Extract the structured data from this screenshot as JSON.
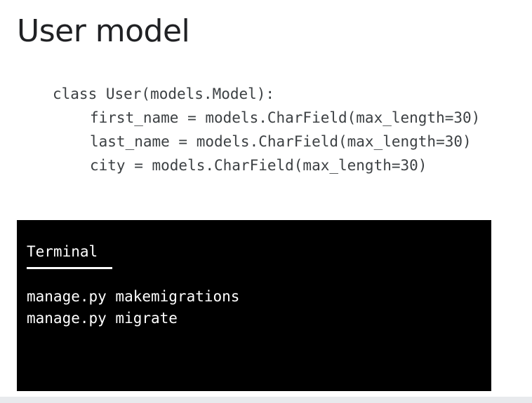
{
  "slide": {
    "title": "User model"
  },
  "code": {
    "lines": [
      "class User(models.Model):",
      "first_name = models.CharField(max_length=30)",
      "last_name = models.CharField(max_length=30)",
      "city = models.CharField(max_length=30)"
    ]
  },
  "terminal": {
    "header": "Terminal",
    "commands": [
      "manage.py makemigrations",
      "manage.py migrate"
    ]
  },
  "colors": {
    "title_text": "#202124",
    "code_text": "#3c4043",
    "terminal_background": "#000000",
    "terminal_text": "#ffffff"
  }
}
